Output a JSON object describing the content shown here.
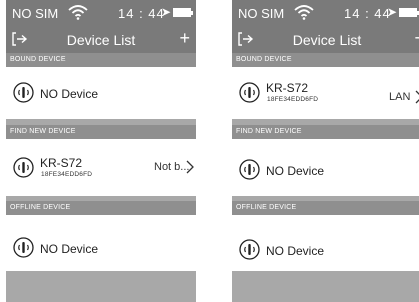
{
  "screens": [
    {
      "status": {
        "carrier": "NO SIM",
        "time": "14 : 44"
      },
      "nav": {
        "title": "Device List",
        "add_label": "+"
      },
      "sections": {
        "bound": {
          "header": "BOUND DEVICE",
          "empty": "NO Device"
        },
        "find": {
          "header": "FIND NEW DEVICE",
          "device_name": "KR-S72",
          "device_id": "18FE34EDD6FD",
          "device_status": "Not b..."
        },
        "offline": {
          "header": "OFFLINE DEVICE",
          "empty": "NO Device"
        }
      }
    },
    {
      "status": {
        "carrier": "NO SIM",
        "time": "14 : 44"
      },
      "nav": {
        "title": "Device List",
        "add_label": "+"
      },
      "sections": {
        "bound": {
          "header": "BOUND DEVICE",
          "device_name": "KR-S72",
          "device_id": "18FE34EDD6FD",
          "device_status": "LAN"
        },
        "find": {
          "header": "FIND NEW DEVICE",
          "empty": "NO Device"
        },
        "offline": {
          "header": "OFFLINE DEVICE",
          "empty": "NO Device"
        }
      }
    }
  ],
  "icons": {
    "wifi": "wifi-icon",
    "back": "back-arrow-icon",
    "location": "location-arrow-icon",
    "battery": "battery-icon",
    "device": "speaker-device-icon",
    "chevron": "chevron-right-icon"
  },
  "colors": {
    "bar": "#7a7a7a",
    "section_header": "#8f8f8f",
    "gray_band": "#a8a8a8",
    "row": "#ffffff"
  }
}
